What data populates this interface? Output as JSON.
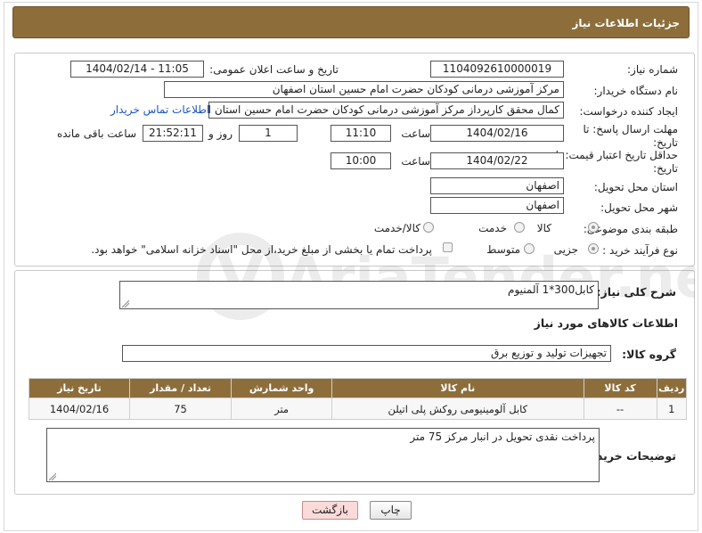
{
  "header": {
    "title": "جزئیات اطلاعات نیاز"
  },
  "form": {
    "need_number_label": "شماره نیاز:",
    "need_number": "1104092610000019",
    "announce_label": "تاریخ و ساعت اعلان عمومی:",
    "announce_value": "1404/02/14 - 11:05",
    "buyer_org_label": "نام دستگاه خریدار:",
    "buyer_org": "مرکز آموزشی درمانی کودکان حضرت امام حسین استان اصفهان",
    "requester_label": "ایجاد کننده درخواست:",
    "requester": "کمال محقق کارپرداز مرکز آموزشی درمانی کودکان حضرت امام حسین استان اص",
    "buyer_contact_link": "اطلاعات تماس خریدار",
    "reply_deadline_label": "مهلت ارسال پاسخ: تا تاریخ:",
    "reply_date": "1404/02/16",
    "time_label": "ساعت",
    "reply_time": "11:10",
    "days_value": "1",
    "days_label": "روز و",
    "remaining_time": "21:52:11",
    "remaining_label": "ساعت باقی مانده",
    "price_validity_label": "حداقل تاریخ اعتبار قیمت: تا تاریخ:",
    "price_date": "1404/02/22",
    "price_time": "10:00",
    "delivery_province_label": "استان محل تحویل:",
    "delivery_province": "اصفهان",
    "delivery_city_label": "شهر محل تحویل:",
    "delivery_city": "اصفهان",
    "category_label": "طبقه بندی موضوعی:",
    "category_options": [
      "کالا",
      "خدمت",
      "کالا/خدمت"
    ],
    "process_label": "نوع فرآیند خرید :",
    "process_options": [
      "جزیی",
      "متوسط"
    ],
    "payment_note": "پرداخت تمام یا بخشی از مبلغ خرید،از محل \"اسناد خزانه اسلامی\" خواهد بود."
  },
  "details": {
    "description_label": "شرح کلی نیاز:",
    "description": "کابل300*1 آلمنیوم",
    "goods_info_title": "اطلاعات کالاهای مورد نیاز",
    "goods_group_label": "گروه کالا:",
    "goods_group": "تجهیزات تولید و توزیع برق",
    "table": {
      "headers": [
        "ردیف",
        "کد کالا",
        "نام کالا",
        "واحد شمارش",
        "تعداد / مقدار",
        "تاریخ نیاز"
      ],
      "rows": [
        [
          "1",
          "--",
          "کابل آلومینیومی روکش پلی اتیلن",
          "متر",
          "75",
          "1404/02/16"
        ]
      ]
    },
    "buyer_notes_label": "توضیحات خریدار:",
    "buyer_notes": "پرداخت نقدی تحویل در انبار مرکز 75 متر"
  },
  "buttons": {
    "print": "چاپ",
    "back": "بازگشت"
  },
  "watermark": {
    "text": "AriaTender.net"
  }
}
